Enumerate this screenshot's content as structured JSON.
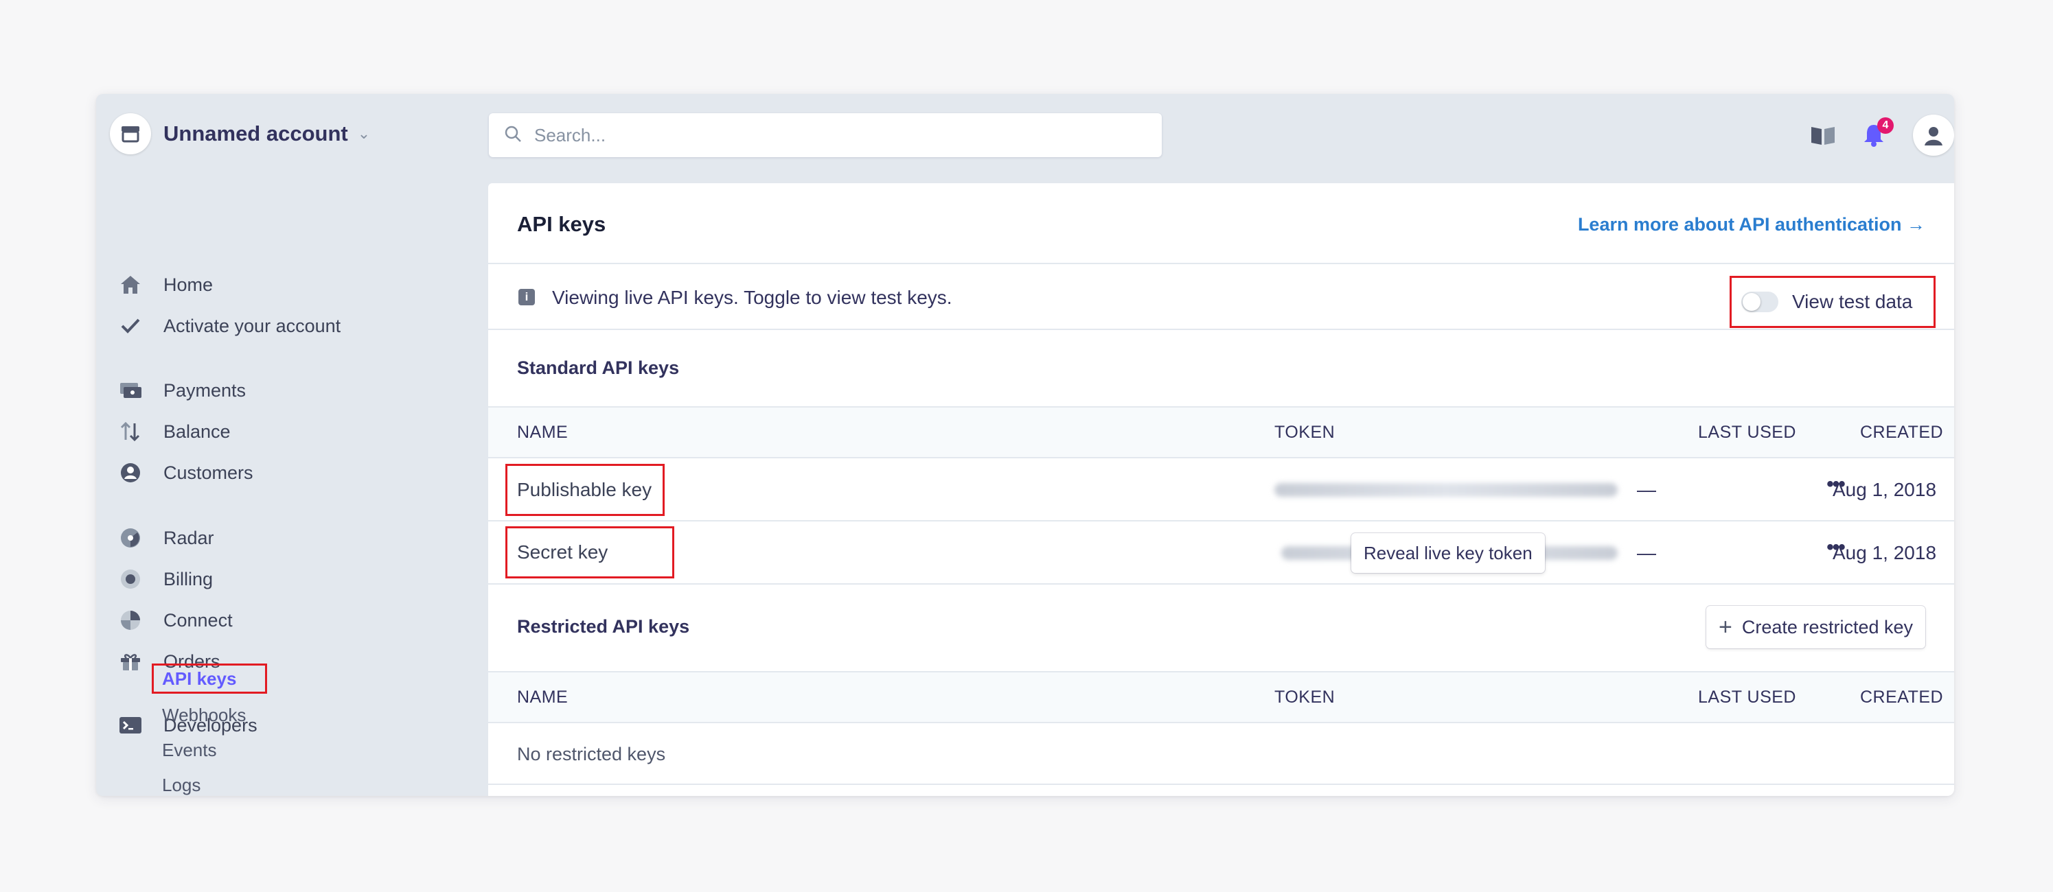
{
  "account": {
    "name": "Unnamed account"
  },
  "search": {
    "placeholder": "Search..."
  },
  "notifications": {
    "count": "4"
  },
  "sidebar": {
    "items": [
      {
        "label": "Home"
      },
      {
        "label": "Activate your account"
      },
      {
        "label": "Payments"
      },
      {
        "label": "Balance"
      },
      {
        "label": "Customers"
      },
      {
        "label": "Radar"
      },
      {
        "label": "Billing"
      },
      {
        "label": "Connect"
      },
      {
        "label": "Orders"
      },
      {
        "label": "Developers"
      }
    ],
    "developers_sub": [
      {
        "label": "API keys"
      },
      {
        "label": "Webhooks"
      },
      {
        "label": "Events"
      },
      {
        "label": "Logs"
      }
    ]
  },
  "panel": {
    "title": "API keys",
    "learn_link": "Learn more about API authentication →",
    "notice": "Viewing live API keys. Toggle to view test keys.",
    "notice_icon": "i",
    "test_toggle_label": "View test data",
    "test_toggle_on": false
  },
  "standard": {
    "title": "Standard API keys",
    "columns": [
      "NAME",
      "TOKEN",
      "LAST USED",
      "CREATED"
    ],
    "rows": [
      {
        "name": "Publishable key",
        "last_used": "—",
        "created": "Aug 1, 2018",
        "more": "•••"
      },
      {
        "name": "Secret key",
        "reveal": "Reveal live key token",
        "last_used": "—",
        "created": "Aug 1, 2018",
        "more": "•••"
      }
    ]
  },
  "restricted": {
    "title": "Restricted API keys",
    "create_label": "Create restricted key",
    "columns": [
      "NAME",
      "TOKEN",
      "LAST USED",
      "CREATED"
    ],
    "empty": "No restricted keys"
  },
  "colors": {
    "accent": "#635bff",
    "link": "#2a7dcf",
    "highlight": "#e21b23",
    "badge": "#e3186e"
  }
}
